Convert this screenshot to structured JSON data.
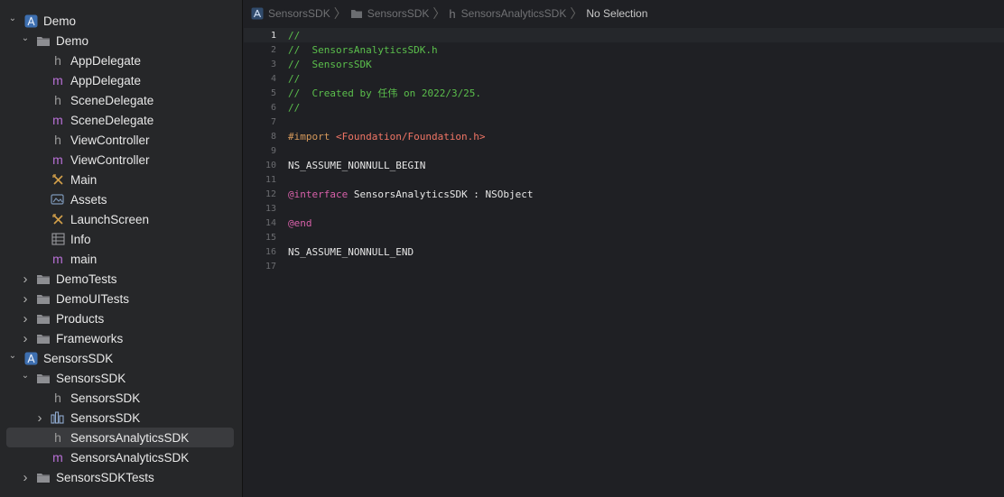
{
  "navigator": {
    "rows": [
      {
        "label": "Demo",
        "depth": 0,
        "chev": "down",
        "icon": "project"
      },
      {
        "label": "Demo",
        "depth": 1,
        "chev": "down",
        "icon": "folder"
      },
      {
        "label": "AppDelegate",
        "depth": 2,
        "icon": "h"
      },
      {
        "label": "AppDelegate",
        "depth": 2,
        "icon": "m"
      },
      {
        "label": "SceneDelegate",
        "depth": 2,
        "icon": "h"
      },
      {
        "label": "SceneDelegate",
        "depth": 2,
        "icon": "m"
      },
      {
        "label": "ViewController",
        "depth": 2,
        "icon": "h"
      },
      {
        "label": "ViewController",
        "depth": 2,
        "icon": "m"
      },
      {
        "label": "Main",
        "depth": 2,
        "icon": "storyboard"
      },
      {
        "label": "Assets",
        "depth": 2,
        "icon": "assets"
      },
      {
        "label": "LaunchScreen",
        "depth": 2,
        "icon": "storyboard"
      },
      {
        "label": "Info",
        "depth": 2,
        "icon": "plist"
      },
      {
        "label": "main",
        "depth": 2,
        "icon": "m"
      },
      {
        "label": "DemoTests",
        "depth": 1,
        "chev": "right",
        "icon": "folder"
      },
      {
        "label": "DemoUITests",
        "depth": 1,
        "chev": "right",
        "icon": "folder"
      },
      {
        "label": "Products",
        "depth": 1,
        "chev": "right",
        "icon": "folder"
      },
      {
        "label": "Frameworks",
        "depth": 1,
        "chev": "right",
        "icon": "folder"
      },
      {
        "label": "SensorsSDK",
        "depth": 0,
        "chev": "down",
        "icon": "project"
      },
      {
        "label": "SensorsSDK",
        "depth": 1,
        "chev": "down",
        "icon": "folder"
      },
      {
        "label": "SensorsSDK",
        "depth": 2,
        "icon": "h"
      },
      {
        "label": "SensorsSDK",
        "depth": 2,
        "chev": "right",
        "icon": "framework"
      },
      {
        "label": "SensorsAnalyticsSDK",
        "depth": 2,
        "icon": "h",
        "selected": true
      },
      {
        "label": "SensorsAnalyticsSDK",
        "depth": 2,
        "icon": "m"
      },
      {
        "label": "SensorsSDKTests",
        "depth": 1,
        "chev": "right",
        "icon": "folder"
      }
    ]
  },
  "jumpbar": {
    "project": "SensorsSDK",
    "folder": "SensorsSDK",
    "file": "SensorsAnalyticsSDK",
    "selection": "No Selection"
  },
  "editor": {
    "active_line": 1,
    "lines": [
      {
        "n": "1",
        "tokens": [
          {
            "t": "//",
            "c": "comment"
          }
        ]
      },
      {
        "n": "2",
        "tokens": [
          {
            "t": "//  SensorsAnalyticsSDK.h",
            "c": "comment"
          }
        ]
      },
      {
        "n": "3",
        "tokens": [
          {
            "t": "//  SensorsSDK",
            "c": "comment"
          }
        ]
      },
      {
        "n": "4",
        "tokens": [
          {
            "t": "//",
            "c": "comment"
          }
        ]
      },
      {
        "n": "5",
        "tokens": [
          {
            "t": "//  Created by 任伟 on 2022/3/25.",
            "c": "comment"
          }
        ]
      },
      {
        "n": "6",
        "tokens": [
          {
            "t": "//",
            "c": "comment"
          }
        ]
      },
      {
        "n": "7",
        "tokens": []
      },
      {
        "n": "8",
        "tokens": [
          {
            "t": "#import ",
            "c": "pre"
          },
          {
            "t": "<Foundation/Foundation.h>",
            "c": "str"
          }
        ]
      },
      {
        "n": "9",
        "tokens": []
      },
      {
        "n": "10",
        "tokens": [
          {
            "t": "NS_ASSUME_NONNULL_BEGIN",
            "c": "plain"
          }
        ]
      },
      {
        "n": "11",
        "tokens": []
      },
      {
        "n": "12",
        "tokens": [
          {
            "t": "@interface",
            "c": "kw"
          },
          {
            "t": " SensorsAnalyticsSDK : NSObject",
            "c": "plain"
          }
        ]
      },
      {
        "n": "13",
        "tokens": []
      },
      {
        "n": "14",
        "tokens": [
          {
            "t": "@end",
            "c": "kw"
          }
        ]
      },
      {
        "n": "15",
        "tokens": []
      },
      {
        "n": "16",
        "tokens": [
          {
            "t": "NS_ASSUME_NONNULL_END",
            "c": "plain"
          }
        ]
      },
      {
        "n": "17",
        "tokens": []
      }
    ]
  }
}
